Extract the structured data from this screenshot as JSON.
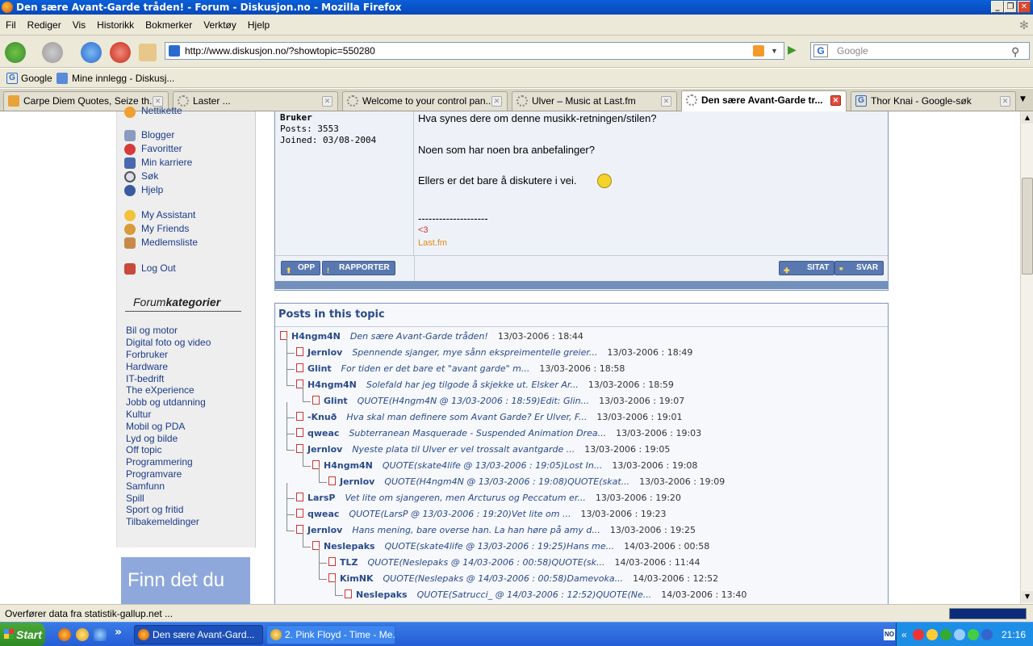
{
  "window": {
    "title": "Den sære Avant-Garde tråden! - Forum - Diskusjon.no - Mozilla Firefox"
  },
  "menu": [
    "Fil",
    "Rediger",
    "Vis",
    "Historikk",
    "Bokmerker",
    "Verktøy",
    "Hjelp"
  ],
  "nav": {
    "url": "http://www.diskusjon.no/?showtopic=550280",
    "search_placeholder": "Google"
  },
  "bookmarks": [
    "Google",
    "Mine innlegg - Diskusj..."
  ],
  "tabs": [
    {
      "label": "Carpe Diem Quotes, Seize th..."
    },
    {
      "label": "Laster ..."
    },
    {
      "label": "Welcome to your control pan..."
    },
    {
      "label": "Ulver – Music at Last.fm"
    },
    {
      "label": "Den sære Avant-Garde tr...",
      "active": true
    },
    {
      "label": "Thor Knai - Google-søk"
    }
  ],
  "sidebar": {
    "partial_top": "Nettikette",
    "links": [
      "Blogger",
      "Favoritter",
      "Min karriere",
      "Søk",
      "Hjelp"
    ],
    "links2": [
      "My Assistant",
      "My Friends",
      "Medlemsliste"
    ],
    "logout": "Log Out",
    "forum_heading_a": "Forum",
    "forum_heading_b": "kategorier",
    "categories": [
      "Bil og motor",
      "Digital foto og video",
      "Forbruker",
      "Hardware",
      "IT-bedrift",
      "The eXperience",
      "Jobb og utdanning",
      "Kultur",
      "Mobil og PDA",
      "Lyd og bilde",
      "Off topic",
      "Programmering",
      "Programvare",
      "Samfunn",
      "Spill",
      "Sport og fritid",
      "Tilbakemeldinger"
    ],
    "ad_text": "Finn det du"
  },
  "post": {
    "role": "Bruker",
    "posts": "Posts: 3553",
    "joined": "Joined: 03/08-2004",
    "line1": "Hva synes dere om denne musikk-retningen/stilen?",
    "line2": "Noen som har noen bra anbefalinger?",
    "line3": "Ellers er det bare å diskutere i vei.",
    "separator": "--------------------",
    "sig1": "<3",
    "sig2": "Last.fm",
    "btn_opp": "OPP",
    "btn_rapporter": "RAPPORTER",
    "btn_sitat": "SITAT",
    "btn_svar": "SVAR"
  },
  "topic": {
    "heading": "Posts in this topic",
    "rows": [
      {
        "author": "H4ngm4N",
        "title": "Den sære Avant-Garde tråden!",
        "date": "13/03-2006 : 18:44",
        "depth": 0
      },
      {
        "author": "Jernlov",
        "title": "Spennende sjanger, mye sånn ekspreimentelle greier...",
        "date": "13/03-2006 : 18:49",
        "depth": 1
      },
      {
        "author": "Glint",
        "title": "For tiden er det bare et \"avant garde\" m...",
        "date": "13/03-2006 : 18:58",
        "depth": 1
      },
      {
        "author": "H4ngm4N",
        "title": "Solefald har jeg tilgode å skjekke ut. Elsker Ar...",
        "date": "13/03-2006 : 18:59",
        "depth": 1
      },
      {
        "author": "Glint",
        "title": "QUOTE(H4ngm4N @ 13/03-2006 : 18:59)Edit: Glin...",
        "date": "13/03-2006 : 19:07",
        "depth": 2
      },
      {
        "author": "-Knuð",
        "title": "Hva skal man definere som Avant Garde? Er Ulver, F...",
        "date": "13/03-2006 : 19:01",
        "depth": 1
      },
      {
        "author": "qweac",
        "title": "Subterranean Masquerade - Suspended Animation Drea...",
        "date": "13/03-2006 : 19:03",
        "depth": 1
      },
      {
        "author": "Jernlov",
        "title": "Nyeste plata til Ulver er vel trossalt avantgarde ...",
        "date": "13/03-2006 : 19:05",
        "depth": 1
      },
      {
        "author": "H4ngm4N",
        "title": "QUOTE(skate4life @ 13/03-2006 : 19:05)Lost In...",
        "date": "13/03-2006 : 19:08",
        "depth": 2
      },
      {
        "author": "Jernlov",
        "title": "QUOTE(H4ngm4N @ 13/03-2006 : 19:08)QUOTE(skat...",
        "date": "13/03-2006 : 19:09",
        "depth": 3
      },
      {
        "author": "LarsP",
        "title": "Vet lite om sjangeren, men Arcturus og Peccatum er...",
        "date": "13/03-2006 : 19:20",
        "depth": 1
      },
      {
        "author": "qweac",
        "title": "QUOTE(LarsP @ 13/03-2006 : 19:20)Vet lite om ...",
        "date": "13/03-2006 : 19:23",
        "depth": 1
      },
      {
        "author": "Jernlov",
        "title": "Hans mening, bare overse han. La han høre på amy d...",
        "date": "13/03-2006 : 19:25",
        "depth": 1
      },
      {
        "author": "Neslepaks",
        "title": "QUOTE(skate4life @ 13/03-2006 : 19:25)Hans me...",
        "date": "14/03-2006 : 00:58",
        "depth": 2
      },
      {
        "author": "TLZ",
        "title": "QUOTE(Neslepaks @ 14/03-2006 : 00:58)QUOTE(sk...",
        "date": "14/03-2006 : 11:44",
        "depth": 3
      },
      {
        "author": "KimNK",
        "title": "QUOTE(Neslepaks @ 14/03-2006 : 00:58)Damevoka...",
        "date": "14/03-2006 : 12:52",
        "depth": 3
      },
      {
        "author": "Neslepaks",
        "title": "QUOTE(Satrucci_ @ 14/03-2006 : 12:52)QUOTE(Ne...",
        "date": "14/03-2006 : 13:40",
        "depth": 4
      }
    ]
  },
  "status": {
    "text": "Overfører data fra statistik-gallup.net ..."
  },
  "taskbar": {
    "start": "Start",
    "items": [
      "Den sære Avant-Gard...",
      "2. Pink Floyd - Time - Me..."
    ],
    "clock": "21:16"
  }
}
